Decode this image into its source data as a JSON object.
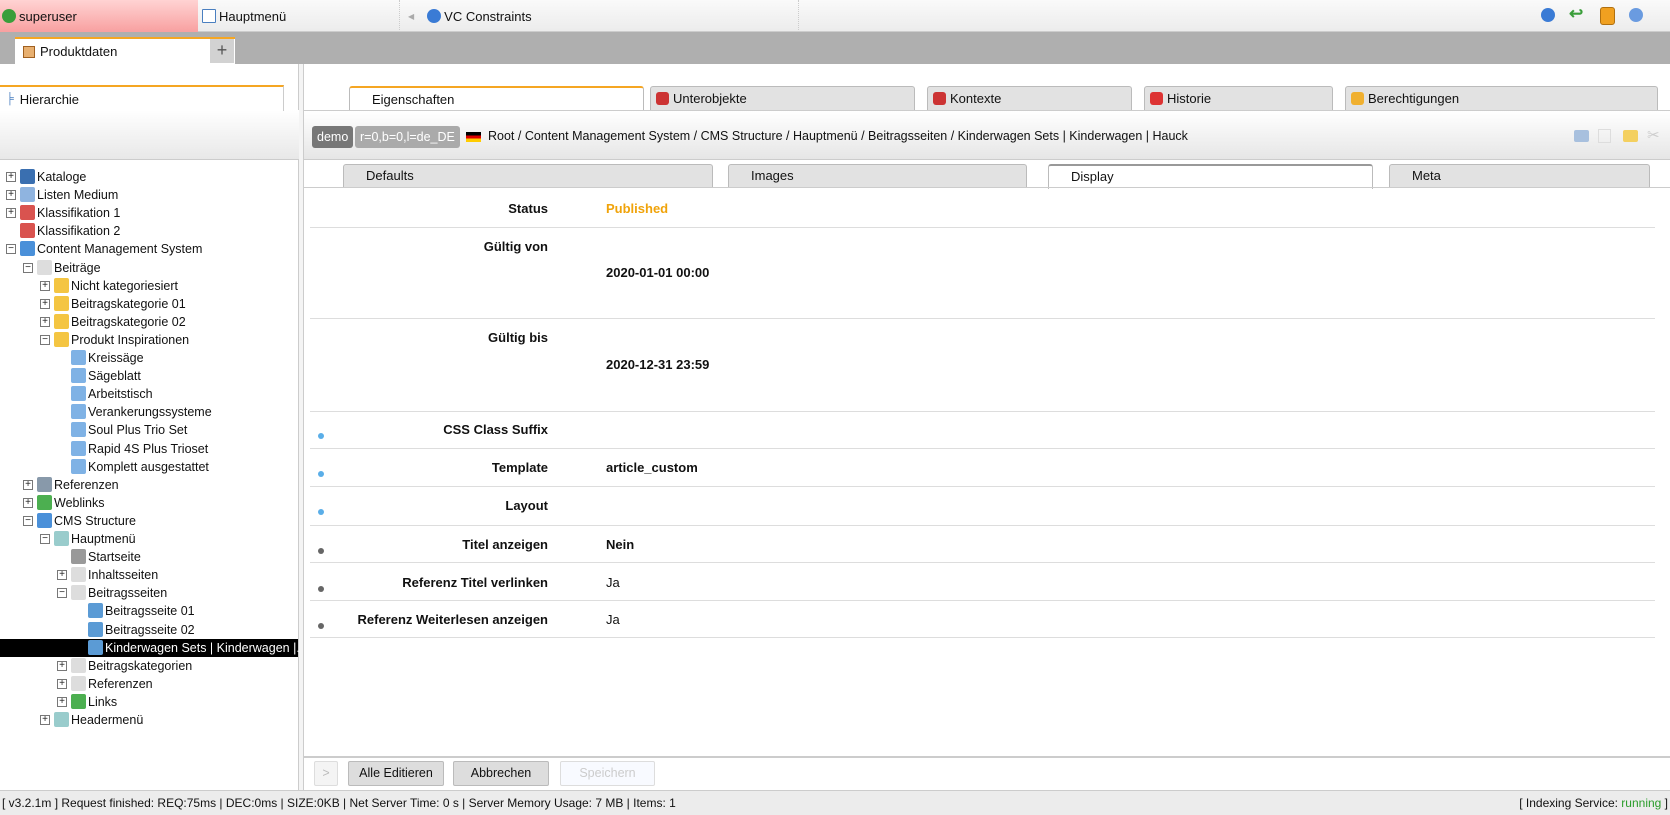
{
  "topbar": {
    "user": "superuser",
    "menu": "Hauptmenü",
    "constraints": "VC Constraints",
    "icons": [
      "help-icon",
      "undo-icon",
      "clipboard-icon",
      "info-icon"
    ]
  },
  "tabs": {
    "main": "Produktdaten",
    "add": "+"
  },
  "left": {
    "header": "Hierarchie"
  },
  "tree": [
    {
      "label": "Kataloge",
      "depth": 0,
      "toggle": "+",
      "icon": "catalog",
      "color": "#3a6fb0"
    },
    {
      "label": "Listen Medium",
      "depth": 0,
      "toggle": "+",
      "icon": "list",
      "color": "#8fb4e0"
    },
    {
      "label": "Klassifikation 1",
      "depth": 0,
      "toggle": "+",
      "icon": "cubes",
      "color": "#d9534f"
    },
    {
      "label": "Klassifikation 2",
      "depth": 0,
      "toggle": "",
      "icon": "cubes",
      "color": "#d9534f"
    },
    {
      "label": "Content Management System",
      "depth": 0,
      "toggle": "-",
      "icon": "cms",
      "color": "#4a90d9"
    },
    {
      "label": "Beiträge",
      "depth": 1,
      "toggle": "-",
      "icon": "page",
      "color": "#ddd"
    },
    {
      "label": "Nicht kategoriesiert",
      "depth": 2,
      "toggle": "+",
      "icon": "folder",
      "color": "#f4c542"
    },
    {
      "label": "Beitragskategorie 01",
      "depth": 2,
      "toggle": "+",
      "icon": "folder",
      "color": "#f4c542"
    },
    {
      "label": "Beitragskategorie 02",
      "depth": 2,
      "toggle": "+",
      "icon": "folder",
      "color": "#f4c542"
    },
    {
      "label": "Produkt Inspirationen",
      "depth": 2,
      "toggle": "-",
      "icon": "folder",
      "color": "#f4c542"
    },
    {
      "label": "Kreissäge",
      "depth": 3,
      "toggle": "",
      "icon": "article",
      "color": "#7fb2e5"
    },
    {
      "label": "Sägeblatt",
      "depth": 3,
      "toggle": "",
      "icon": "article",
      "color": "#7fb2e5"
    },
    {
      "label": "Arbeitstisch",
      "depth": 3,
      "toggle": "",
      "icon": "article",
      "color": "#7fb2e5"
    },
    {
      "label": "Verankerungssysteme",
      "depth": 3,
      "toggle": "",
      "icon": "article",
      "color": "#7fb2e5"
    },
    {
      "label": "Soul Plus Trio Set",
      "depth": 3,
      "toggle": "",
      "icon": "article",
      "color": "#7fb2e5"
    },
    {
      "label": "Rapid 4S Plus Trioset",
      "depth": 3,
      "toggle": "",
      "icon": "article",
      "color": "#7fb2e5"
    },
    {
      "label": "Komplett ausgestattet",
      "depth": 3,
      "toggle": "",
      "icon": "article",
      "color": "#7fb2e5"
    },
    {
      "label": "Referenzen",
      "depth": 1,
      "toggle": "+",
      "icon": "server",
      "color": "#8899aa"
    },
    {
      "label": "Weblinks",
      "depth": 1,
      "toggle": "+",
      "icon": "globe",
      "color": "#4caf50"
    },
    {
      "label": "CMS Structure",
      "depth": 1,
      "toggle": "-",
      "icon": "structure",
      "color": "#4a90d9"
    },
    {
      "label": "Hauptmenü",
      "depth": 2,
      "toggle": "-",
      "icon": "menu",
      "color": "#9cc"
    },
    {
      "label": "Startseite",
      "depth": 3,
      "toggle": "",
      "icon": "page",
      "color": "#999"
    },
    {
      "label": "Inhaltsseiten",
      "depth": 3,
      "toggle": "+",
      "icon": "page",
      "color": "#ddd"
    },
    {
      "label": "Beitragsseiten",
      "depth": 3,
      "toggle": "-",
      "icon": "page",
      "color": "#ddd"
    },
    {
      "label": "Beitragsseite 01",
      "depth": 4,
      "toggle": "",
      "icon": "article",
      "color": "#5b9bd5"
    },
    {
      "label": "Beitragsseite 02",
      "depth": 4,
      "toggle": "",
      "icon": "article",
      "color": "#5b9bd5"
    },
    {
      "label": "Kinderwagen Sets | Kinderwagen |...",
      "depth": 4,
      "toggle": "",
      "icon": "article",
      "color": "#5b9bd5",
      "selected": true
    },
    {
      "label": "Beitragskategorien",
      "depth": 3,
      "toggle": "+",
      "icon": "page",
      "color": "#ddd"
    },
    {
      "label": "Referenzen",
      "depth": 3,
      "toggle": "+",
      "icon": "page",
      "color": "#ddd"
    },
    {
      "label": "Links",
      "depth": 3,
      "toggle": "+",
      "icon": "globe",
      "color": "#4caf50"
    },
    {
      "label": "Headermenü",
      "depth": 2,
      "toggle": "+",
      "icon": "menu",
      "color": "#9cc"
    }
  ],
  "detail_tabs": [
    "Eigenschaften",
    "Unterobjekte",
    "Kontexte",
    "Historie",
    "Berechtigungen"
  ],
  "breadcrumb": {
    "badge1": "demo",
    "badge2": "r=0,b=0,l=de_DE",
    "path": "Root / Content Management System / CMS Structure / Hauptmenü / Beitragsseiten / Kinderwagen Sets | Kinderwagen | Hauck",
    "toolbar_icons": [
      "add-keyboard-icon",
      "copy-icon",
      "add-folder-icon",
      "cut-icon"
    ]
  },
  "sub_tabs": [
    "Defaults",
    "Images",
    "Display",
    "Meta"
  ],
  "fields": [
    {
      "label": "Status",
      "value": "Published"
    },
    {
      "label": "Gültig von",
      "value": "2020-01-01 00:00"
    },
    {
      "label": "Gültig bis",
      "value": "2020-12-31 23:59"
    },
    {
      "label": "CSS Class Suffix",
      "value": ""
    },
    {
      "label": "Template",
      "value": "article_custom"
    },
    {
      "label": "Layout",
      "value": ""
    },
    {
      "label": "Titel anzeigen",
      "value": "Nein"
    },
    {
      "label": "Referenz Titel verlinken",
      "value": "Ja"
    },
    {
      "label": "Referenz Weiterlesen anzeigen",
      "value": "Ja"
    }
  ],
  "colors": {
    "accent": "#f5a623",
    "published": "#f0a30a",
    "running": "#2a9d2a"
  },
  "buttons": {
    "next": ">",
    "edit_all": "Alle Editieren",
    "cancel": "Abbrechen",
    "save": "Speichern"
  },
  "status": {
    "left": "[ v3.2.1m ] Request finished: REQ:75ms | DEC:0ms | SIZE:0KB | Net Server Time: 0 s | Server Memory Usage: 7 MB | Items: 1",
    "indexing_label": "[ Indexing Service: ",
    "indexing_value": "running",
    "indexing_end": " ]"
  }
}
